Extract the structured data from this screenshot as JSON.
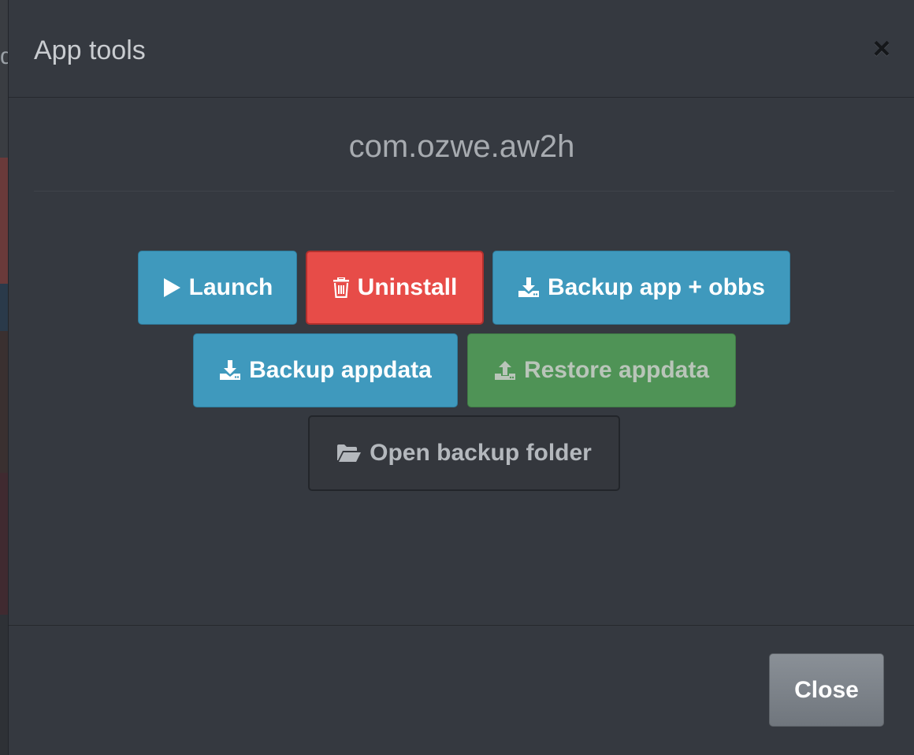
{
  "backdrop": {
    "peek_text": "d"
  },
  "modal": {
    "title": "App tools",
    "close_glyph": "×",
    "package_name": "com.ozwe.aw2h"
  },
  "actions": {
    "launch": {
      "label": "Launch",
      "icon": "play-icon"
    },
    "uninstall": {
      "label": "Uninstall",
      "icon": "trash-icon"
    },
    "backup_app_obbs": {
      "label": "Backup app + obbs",
      "icon": "download-icon"
    },
    "backup_appdata": {
      "label": "Backup appdata",
      "icon": "download-icon"
    },
    "restore_appdata": {
      "label": "Restore appdata",
      "icon": "upload-icon"
    },
    "open_backup_folder": {
      "label": "Open backup folder",
      "icon": "folder-open-icon"
    }
  },
  "footer": {
    "close_label": "Close"
  },
  "colors": {
    "modal_bg": "#353940",
    "primary": "#3f99bd",
    "danger": "#e74c48",
    "success": "#4f9356",
    "secondary": "#7a8087"
  }
}
